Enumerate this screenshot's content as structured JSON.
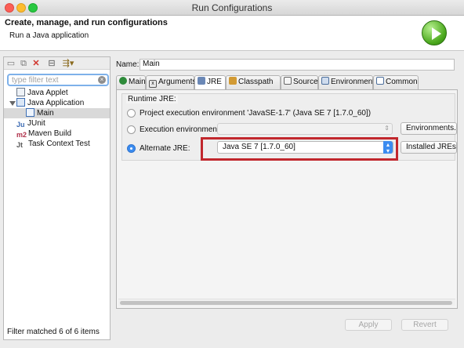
{
  "window": {
    "title": "Run Configurations"
  },
  "header": {
    "title": "Create, manage, and run configurations",
    "subtitle": "Run a Java application",
    "icon": "run-icon"
  },
  "left": {
    "toolbar": [
      "new-config-icon",
      "duplicate-icon",
      "delete-icon",
      "collapse-all-icon",
      "filter-menu-icon"
    ],
    "filter_placeholder": "type filter text",
    "tree": [
      {
        "label": "Java Applet",
        "icon": "java-applet-icon"
      },
      {
        "label": "Java Application",
        "icon": "java-application-icon",
        "expanded": true
      },
      {
        "label": "Main",
        "icon": "main-config-icon",
        "selected": true
      },
      {
        "label": "JUnit",
        "icon": "junit-icon"
      },
      {
        "label": "Maven Build",
        "icon": "maven-icon"
      },
      {
        "label": "Task Context Test",
        "icon": "task-context-icon"
      }
    ],
    "status": "Filter matched 6 of 6 items"
  },
  "right": {
    "name_label": "Name:",
    "name_value": "Main",
    "tabs": [
      {
        "label": "Main"
      },
      {
        "label": "Arguments"
      },
      {
        "label": "JRE",
        "active": true
      },
      {
        "label": "Classpath"
      },
      {
        "label": "Source"
      },
      {
        "label": "Environment"
      },
      {
        "label": "Common"
      }
    ],
    "runtime_jre": {
      "group_label": "Runtime JRE:",
      "option_project": "Project execution environment 'JavaSE-1.7' (Java SE 7 [1.7.0_60])",
      "option_execution": "Execution environment:",
      "execution_value": "",
      "environments_button": "Environments...",
      "option_alternate": "Alternate JRE:",
      "alternate_value": "Java SE 7 [1.7.0_60]",
      "installed_button": "Installed JREs...",
      "selected_option": "alternate"
    },
    "apply_button": "Apply",
    "revert_button": "Revert"
  },
  "colors": {
    "highlight": "#c1272d",
    "accent": "#3b8cf0"
  }
}
